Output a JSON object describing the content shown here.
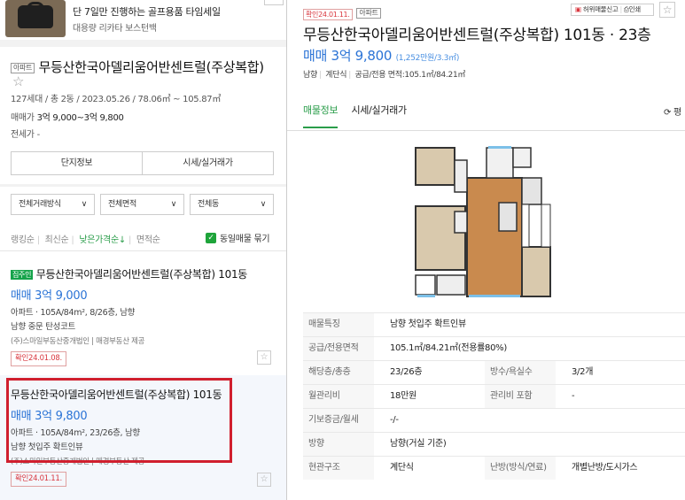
{
  "ad": {
    "title": "단 7일만 진행하는 골프용품 타임세일",
    "subtitle": "대용량 리카타 보스턴백"
  },
  "complex": {
    "tag": "아파트",
    "name": "무등산한국아델리움어반센트럴(주상복합)",
    "star": "☆",
    "info": "127세대 / 총 2동 / 2023.05.26 / 78.06㎡ ~ 105.87㎡",
    "price_label": "매매가",
    "price_value": "3억 9,000~3억 9,800",
    "rent_label": "전세가",
    "rent_value": "-",
    "btn_info": "단지정보",
    "btn_trade": "시세/실거래가"
  },
  "filters": {
    "trade": "전체거래방식",
    "area": "전체면적",
    "dong": "전체동",
    "chevron": "∨"
  },
  "sort": {
    "recent_rank": "랭킹순",
    "latest": "최신순",
    "low_price": "낮은가격순",
    "low_arrow": "↓",
    "area": "면적순",
    "same_label": "동일매물 묶기",
    "check": "✓"
  },
  "listings": [
    {
      "owner_tag": "집주인",
      "title": "무등산한국아델리움어반센트럴(주상복합) 101동",
      "price": "매매 3억 9,000",
      "detail": "아파트 · 105A/84m², 8/26층, 남향",
      "desc": "남향 중문 탄성코트",
      "agent": "(주)스마일부동산중개법인 | 매경부동산 제공",
      "confirm": "확인24.01.08.",
      "fav": "☆"
    },
    {
      "title": "무등산한국아델리움어반센트럴(주상복합) 101동",
      "price": "매매 3억 9,800",
      "detail": "아파트 · 105A/84m², 23/26층, 남향",
      "desc": "남향 첫입주 확트인뷰",
      "agent": "(주)스마일부동산중개법인 | 매경부동산 제공",
      "confirm": "확인24.01.11.",
      "fav": "☆"
    }
  ],
  "detail": {
    "confirm_tag": "확인24.01.11.",
    "type_tag": "아파트",
    "report_label": "허위매물신고",
    "print_label": "인쇄",
    "star": "☆",
    "title": "무등산한국아델리움어반센트럴(주상복합) 101동 · 23층",
    "price": "매매 3억 9,800",
    "price_per": "(1,252만원/3.3㎡)",
    "spec_dir": "남향",
    "spec_type": "계단식",
    "spec_area": "공급/전용 면적:105.1㎡/84.21㎡",
    "tab_info": "매물정보",
    "tab_trade": "시세/실거래가",
    "refresh": "⟳ 평",
    "table": [
      {
        "k": "매물특징",
        "v": "남향 첫입주 확트인뷰"
      },
      {
        "k": "공급/전용면적",
        "v": "105.1㎡/84.21㎡(전용률80%)"
      },
      {
        "k": "해당층/총층",
        "v": "23/26층",
        "k2": "방수/욕실수",
        "v2": "3/2개"
      },
      {
        "k": "월관리비",
        "v": "18만원",
        "k2": "관리비 포함",
        "v2": "-"
      },
      {
        "k": "기보증금/월세",
        "v": "-/-"
      },
      {
        "k": "방향",
        "v": "남향(거실 기준)"
      },
      {
        "k": "현관구조",
        "v": "계단식",
        "k2": "난방(방식/연료)",
        "v2": "개별난방/도시가스"
      }
    ]
  },
  "colors": {
    "accent_green": "#2a9d4a",
    "price_blue": "#2a73d6",
    "highlight_red": "#d01f2e"
  }
}
